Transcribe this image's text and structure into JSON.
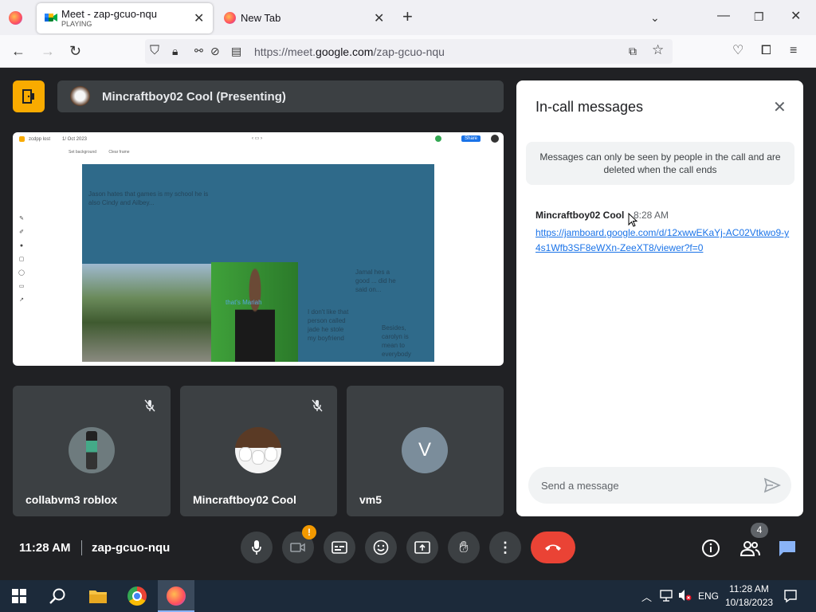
{
  "browser": {
    "tabs": [
      {
        "title": "Meet - zap-gcuo-nqu",
        "subtitle": "PLAYING"
      },
      {
        "title": "New Tab"
      }
    ],
    "url_prefix": "https://meet.",
    "url_domain": "google.com",
    "url_path": "/zap-gcuo-nqu"
  },
  "presenter": {
    "label": "Mincraftboy02 Cool (Presenting)"
  },
  "shared_screen": {
    "app_title": "zcdpp lost",
    "date": "1/ Oct 2023",
    "share_button": "Share",
    "menu_items": [
      "Set background",
      "Clear frame"
    ],
    "note_texts": [
      "Jason hates that games is my school he is also Cindy and Ailbey...",
      "Jamal hes a good ... did he said on...",
      "I don't like that person called jade he stole my boyfriend",
      "Besides, carolyn is mean to everybody"
    ],
    "image_caption": "that's Mariah"
  },
  "participants": [
    {
      "name": "collabvm3 roblox",
      "muted": true,
      "avatar_type": "roblox"
    },
    {
      "name": "Mincraftboy02 Cool",
      "muted": true,
      "avatar_type": "chickens"
    },
    {
      "name": "vm5",
      "muted": false,
      "avatar_letter": "V",
      "avatar_color": "#7b8d9b"
    }
  ],
  "chat": {
    "title": "In-call messages",
    "notice": "Messages can only be seen by people in the call and are deleted when the call ends",
    "messages": [
      {
        "sender": "Mincraftboy02 Cool",
        "time": "8:28 AM",
        "text": "https://jamboard.google.com/d/12xwwEKaYj-AC02Vtkwo9-y4s1Wfb3SF8eWXn-ZeeXT8/viewer?f=0"
      }
    ],
    "input_placeholder": "Send a message"
  },
  "bottom_bar": {
    "time": "11:28 AM",
    "meeting_code": "zap-gcuo-nqu",
    "camera_alert": "!",
    "people_count": "4"
  },
  "taskbar": {
    "language": "ENG",
    "time": "11:28 AM",
    "date": "10/18/2023"
  },
  "colors": {
    "accent": "#8ab4f8",
    "end_call": "#ea4335",
    "badge": "#f29900",
    "chat_link": "#1a73e8"
  }
}
